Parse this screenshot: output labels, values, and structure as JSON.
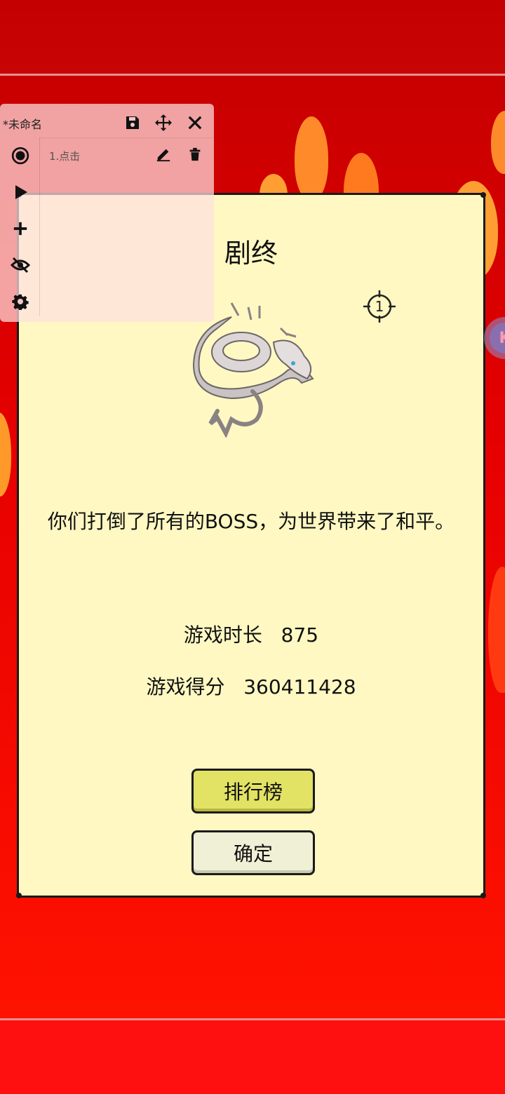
{
  "macro_panel": {
    "title": "*未命名",
    "steps": [
      {
        "label": "1.点击"
      }
    ],
    "icons": [
      "save-icon",
      "move-icon",
      "close-icon",
      "record-icon",
      "edit-icon",
      "delete-icon",
      "play-icon",
      "add-icon",
      "hide-icon",
      "settings-icon"
    ]
  },
  "dialog": {
    "title": "剧终",
    "message": "你们打倒了所有的BOSS，为世界带来了和平。",
    "stats": {
      "play_time_label": "游戏时长",
      "play_time_value": "875",
      "score_label": "游戏得分",
      "score_value": "360411428"
    },
    "buttons": {
      "leaderboard": "排行榜",
      "confirm": "确定"
    }
  },
  "crosshair_number": "1",
  "colors": {
    "dialog_bg": "#fff8c2",
    "leaderboard_btn": "#e2e264",
    "confirm_btn": "#f0f0d6",
    "background_red": "#e60000"
  }
}
